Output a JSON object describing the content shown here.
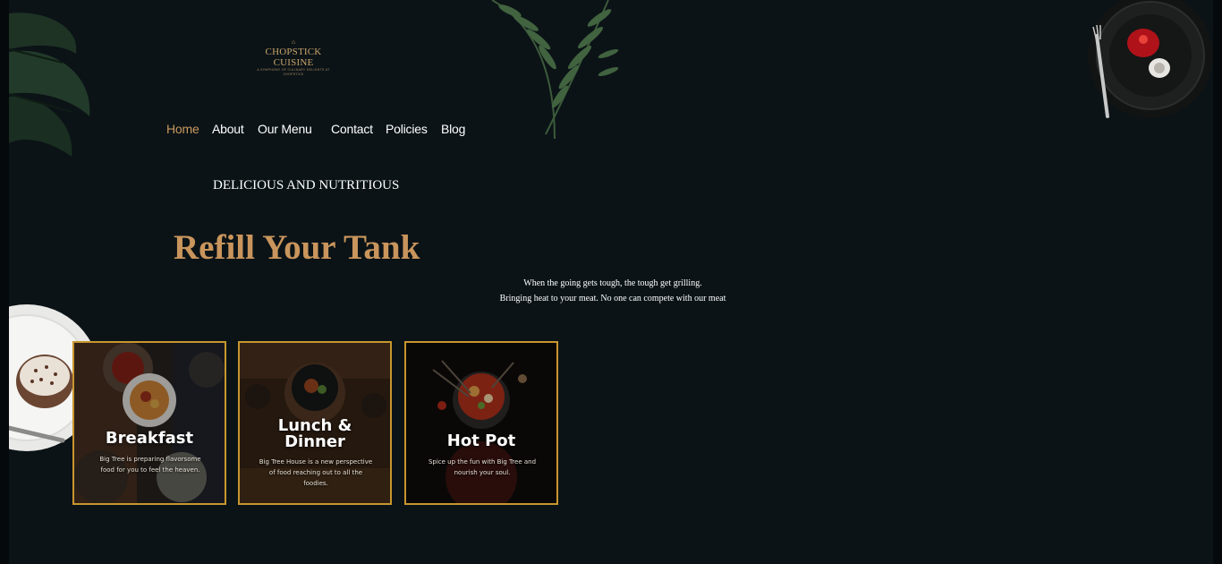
{
  "logo": {
    "name": "CHOPSTICK CUISINE",
    "tagline": "A SYMPHONY OF CULINARY DELIGHTS AT CHOPSTICK"
  },
  "nav": {
    "items": [
      {
        "label": "Home",
        "active": true
      },
      {
        "label": "About",
        "active": false
      },
      {
        "label": "Our Menu",
        "active": false
      },
      {
        "label": "Contact",
        "active": false
      },
      {
        "label": "Policies",
        "active": false
      },
      {
        "label": "Blog",
        "active": false
      }
    ]
  },
  "hero": {
    "eyebrow": "DELICIOUS AND NUTRITIOUS",
    "headline": "Refill Your Tank",
    "tagline_line1": "When the going gets tough, the tough get grilling.",
    "tagline_line2": "Bringing heat to your meat. No one can compete with our meat"
  },
  "cards": [
    {
      "title": "Breakfast",
      "description": "Big Tree is preparing flavorsome food for you to feel the heaven."
    },
    {
      "title_line1": "Lunch &",
      "title_line2": "Dinner",
      "description": "Big Tree House is a new perspective of food reaching out to all the foodies."
    },
    {
      "title": "Hot Pot",
      "description": "Spice up the fun with Big Tree and nourish your soul."
    }
  ],
  "colors": {
    "background": "#0b1317",
    "accent_gold": "#c9955c",
    "card_border": "#c8962e",
    "nav_active": "#c99a5e"
  }
}
